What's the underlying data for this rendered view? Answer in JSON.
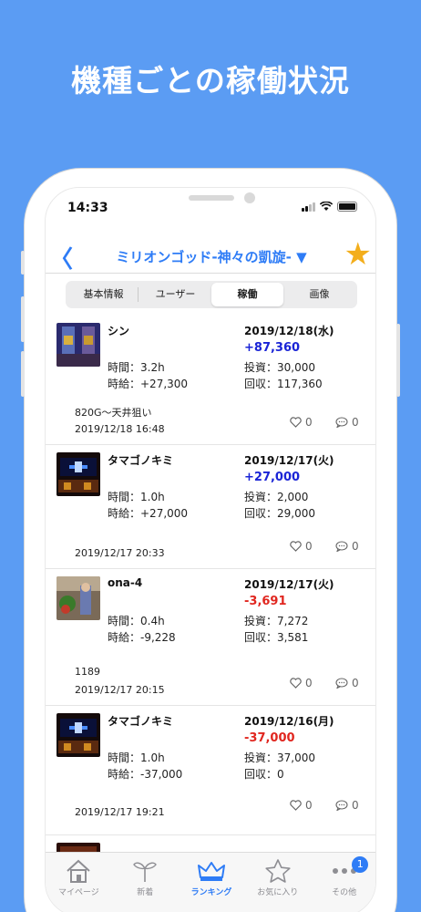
{
  "promo_title": "機種ごとの稼働状況",
  "status_bar": {
    "time": "14:33"
  },
  "nav": {
    "back_symbol": "〈",
    "title": "ミリオンゴッド-神々の凱旋- ▼",
    "star_symbol": "★"
  },
  "segments": [
    {
      "label": "基本情報",
      "active": false
    },
    {
      "label": "ユーザー",
      "active": false
    },
    {
      "label": "稼働",
      "active": true
    },
    {
      "label": "画像",
      "active": false
    }
  ],
  "entries": [
    {
      "user": "シン",
      "date": "2019/12/18(水)",
      "diff": "+87,360",
      "diff_sign": "pos",
      "time": "時間：3.2h",
      "hourly": "時給：+27,300",
      "invest": "投資：30,000",
      "return": "回収：117,360",
      "memo": "820G〜天井狙い",
      "posted": "2019/12/18 16:48",
      "likes": "0",
      "comments": "0"
    },
    {
      "user": "タマゴノキミ",
      "date": "2019/12/17(火)",
      "diff": "+27,000",
      "diff_sign": "pos",
      "time": "時間：1.0h",
      "hourly": "時給：+27,000",
      "invest": "投資：2,000",
      "return": "回収：29,000",
      "memo": "",
      "posted": "2019/12/17 20:33",
      "likes": "0",
      "comments": "0"
    },
    {
      "user": "ona-4",
      "date": "2019/12/17(火)",
      "diff": "-3,691",
      "diff_sign": "neg",
      "time": "時間：0.4h",
      "hourly": "時給：-9,228",
      "invest": "投資：7,272",
      "return": "回収：3,581",
      "memo": "1189",
      "posted": "2019/12/17 20:15",
      "likes": "0",
      "comments": "0"
    },
    {
      "user": "タマゴノキミ",
      "date": "2019/12/16(月)",
      "diff": "-37,000",
      "diff_sign": "neg",
      "time": "時間：1.0h",
      "hourly": "時給：-37,000",
      "invest": "投資：37,000",
      "return": "回収：0",
      "memo": "",
      "posted": "2019/12/17 19:21",
      "likes": "0",
      "comments": "0"
    }
  ],
  "tabbar": [
    {
      "label": "マイページ",
      "icon": "house-icon",
      "active": false
    },
    {
      "label": "新着",
      "icon": "sprout-icon",
      "active": false
    },
    {
      "label": "ランキング",
      "icon": "crown-icon",
      "active": true
    },
    {
      "label": "お気に入り",
      "icon": "star-outline-icon",
      "active": false
    },
    {
      "label": "その他",
      "icon": "more-dots-icon",
      "active": false,
      "badge": "1"
    }
  ],
  "colors": {
    "background": "#5b9cf3",
    "accent": "#2e7cf6",
    "positive": "#1a24d6",
    "negative": "#e0261f",
    "star": "#f3ae1c"
  }
}
